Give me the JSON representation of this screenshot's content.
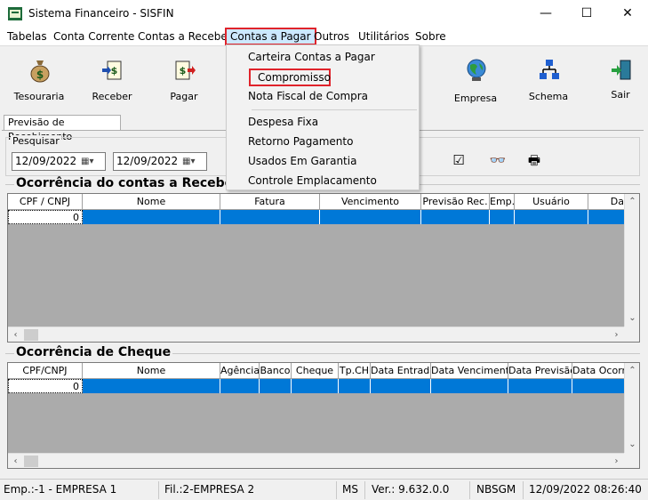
{
  "window": {
    "title": "Sistema Financeiro - SISFIN",
    "controls": {
      "minimize": "—",
      "maximize": "☐",
      "close": "✕"
    }
  },
  "menubar": {
    "items": [
      {
        "label": "Tabelas"
      },
      {
        "label": "Conta Corrente"
      },
      {
        "label": "Contas a Receber"
      },
      {
        "label": "Contas a Pagar",
        "active": true
      },
      {
        "label": "Outros"
      },
      {
        "label": "Utilitários"
      },
      {
        "label": "Sobre"
      }
    ]
  },
  "toolbar": {
    "buttons": [
      {
        "label": "Tesouraria",
        "icon": "money-bag-icon"
      },
      {
        "label": "Receber",
        "icon": "receive-money-icon"
      },
      {
        "label": "Pagar",
        "icon": "pay-money-icon"
      },
      {
        "label": "Empresa",
        "icon": "globe-company-icon"
      },
      {
        "label": "Schema",
        "icon": "org-schema-icon"
      },
      {
        "label": "Sair",
        "icon": "exit-door-icon"
      }
    ],
    "hidden_partial_label": "o"
  },
  "tabs": {
    "active": "Previsão de Recebimento"
  },
  "search": {
    "caption": "Pesquisar",
    "date_from": "12/09/2022",
    "date_to": "12/09/2022"
  },
  "receivables": {
    "title": "Ocorrência do contas a Receber",
    "columns": [
      "CPF / CNPJ",
      "Nome",
      "Fatura",
      "Vencimento",
      "Previsão Rec.",
      "Emp.",
      "Usuário",
      "Da"
    ],
    "rows": [
      {
        "cpf": "0"
      }
    ]
  },
  "cheques": {
    "title": "Ocorrência de Cheque",
    "columns": [
      "CPF/CNPJ",
      "Nome",
      "Agência",
      "Banco",
      "Cheque",
      "Tp.CH",
      "Data Entrada",
      "Data Vencimento",
      "Data Previsão",
      "Data Ocorrê"
    ],
    "rows": [
      {
        "cpf": "0"
      }
    ]
  },
  "dropdown": {
    "items": [
      {
        "label": "Carteira Contas a Pagar"
      },
      {
        "label": "Compromisso",
        "highlighted": true
      },
      {
        "label": "Nota Fiscal de Compra"
      },
      {
        "label": "Despesa Fixa"
      },
      {
        "label": "Retorno Pagamento"
      },
      {
        "label": "Usados Em Garantia"
      },
      {
        "label": "Controle Emplacamento"
      }
    ]
  },
  "statusbar": {
    "empresa": "Emp.:-1 - EMPRESA 1",
    "filial": "Fil.:2-EMPRESA 2",
    "estado": "MS",
    "versao": "Ver.: 9.632.0.0",
    "usuario": "NBSGM",
    "datetime": "12/09/2022 08:26:40"
  }
}
